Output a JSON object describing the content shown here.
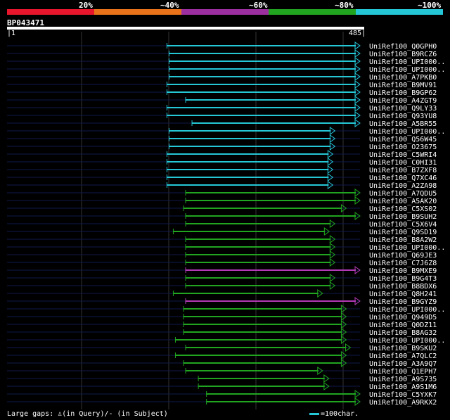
{
  "scale": {
    "labels": [
      "20%",
      "~40%",
      "~60%",
      "~80%",
      "~100%"
    ],
    "band_colors": [
      "#e8162c",
      "#e8731a",
      "#9b2fa0",
      "#21a520",
      "#25c7d6"
    ]
  },
  "query": {
    "name": "BP043471",
    "start": "1",
    "end": "485",
    "length": 485
  },
  "colors": {
    "cyan": "#25c7d6",
    "green": "#21a520",
    "purple": "#b33ab5",
    "track": "#101a4a",
    "grid": "#333"
  },
  "hits": [
    {
      "name": "UniRef100_Q0GPH0",
      "start": 0.453,
      "end": 1.0,
      "color": "cyan"
    },
    {
      "name": "UniRef100_B9RCZ6",
      "start": 0.459,
      "end": 1.0,
      "color": "cyan"
    },
    {
      "name": "UniRef100_UPI000..",
      "start": 0.459,
      "end": 1.0,
      "color": "cyan"
    },
    {
      "name": "UniRef100_UPI000..",
      "start": 0.459,
      "end": 1.0,
      "color": "cyan"
    },
    {
      "name": "UniRef100_A7PKB0",
      "start": 0.459,
      "end": 1.0,
      "color": "cyan"
    },
    {
      "name": "UniRef100_B9MV91",
      "start": 0.453,
      "end": 1.0,
      "color": "cyan"
    },
    {
      "name": "UniRef100_B9GP62",
      "start": 0.453,
      "end": 1.0,
      "color": "cyan"
    },
    {
      "name": "UniRef100_A4ZGT9",
      "start": 0.506,
      "end": 1.0,
      "color": "cyan"
    },
    {
      "name": "UniRef100_Q9LY33",
      "start": 0.453,
      "end": 1.0,
      "color": "cyan"
    },
    {
      "name": "UniRef100_Q93YU8",
      "start": 0.453,
      "end": 1.0,
      "color": "cyan"
    },
    {
      "name": "UniRef100_A5BR55",
      "start": 0.524,
      "end": 1.0,
      "color": "cyan"
    },
    {
      "name": "UniRef100_UPI000..",
      "start": 0.459,
      "end": 0.929,
      "color": "cyan"
    },
    {
      "name": "UniRef100_Q56W45",
      "start": 0.459,
      "end": 0.929,
      "color": "cyan"
    },
    {
      "name": "UniRef100_O23675",
      "start": 0.459,
      "end": 0.929,
      "color": "cyan"
    },
    {
      "name": "UniRef100_C5WRI4",
      "start": 0.453,
      "end": 0.923,
      "color": "cyan"
    },
    {
      "name": "UniRef100_C0HI31",
      "start": 0.453,
      "end": 0.923,
      "color": "cyan"
    },
    {
      "name": "UniRef100_B7ZXF8",
      "start": 0.453,
      "end": 0.923,
      "color": "cyan"
    },
    {
      "name": "UniRef100_Q7XC46",
      "start": 0.453,
      "end": 0.923,
      "color": "cyan"
    },
    {
      "name": "UniRef100_A2ZA98",
      "start": 0.453,
      "end": 0.923,
      "color": "cyan"
    },
    {
      "name": "UniRef100_A7QDU5",
      "start": 0.506,
      "end": 1.0,
      "color": "green"
    },
    {
      "name": "UniRef100_A5AK20",
      "start": 0.506,
      "end": 1.0,
      "color": "green"
    },
    {
      "name": "UniRef100_C5XS02",
      "start": 0.5,
      "end": 0.961,
      "color": "green"
    },
    {
      "name": "UniRef100_B9SUH2",
      "start": 0.506,
      "end": 1.0,
      "color": "green"
    },
    {
      "name": "UniRef100_C5X6V4",
      "start": 0.506,
      "end": 0.929,
      "color": "green"
    },
    {
      "name": "UniRef100_Q9SD19",
      "start": 0.471,
      "end": 0.913,
      "color": "green"
    },
    {
      "name": "UniRef100_B8A2W2",
      "start": 0.506,
      "end": 0.929,
      "color": "green"
    },
    {
      "name": "UniRef100_UPI000..",
      "start": 0.506,
      "end": 0.929,
      "color": "green"
    },
    {
      "name": "UniRef100_Q69JE3",
      "start": 0.506,
      "end": 0.929,
      "color": "green"
    },
    {
      "name": "UniRef100_C7J6Z8",
      "start": 0.506,
      "end": 0.929,
      "color": "green"
    },
    {
      "name": "UniRef100_B9MXE9",
      "start": 0.506,
      "end": 1.0,
      "color": "purple"
    },
    {
      "name": "UniRef100_B9G4T3",
      "start": 0.506,
      "end": 0.929,
      "color": "green"
    },
    {
      "name": "UniRef100_B8BDX6",
      "start": 0.506,
      "end": 0.929,
      "color": "green"
    },
    {
      "name": "UniRef100_Q8H241",
      "start": 0.471,
      "end": 0.894,
      "color": "green"
    },
    {
      "name": "UniRef100_B9GYZ9",
      "start": 0.506,
      "end": 1.0,
      "color": "purple"
    },
    {
      "name": "UniRef100_UPI000..",
      "start": 0.5,
      "end": 0.961,
      "color": "green"
    },
    {
      "name": "UniRef100_Q949D5",
      "start": 0.5,
      "end": 0.961,
      "color": "green"
    },
    {
      "name": "UniRef100_Q0DZ11",
      "start": 0.5,
      "end": 0.961,
      "color": "green"
    },
    {
      "name": "UniRef100_B8AG32",
      "start": 0.5,
      "end": 0.961,
      "color": "green"
    },
    {
      "name": "UniRef100_UPI000..",
      "start": 0.477,
      "end": 0.961,
      "color": "green"
    },
    {
      "name": "UniRef100_B9SKU2",
      "start": 0.506,
      "end": 0.973,
      "color": "green"
    },
    {
      "name": "UniRef100_A7QLC2",
      "start": 0.477,
      "end": 0.961,
      "color": "green"
    },
    {
      "name": "UniRef100_A3A9Q7",
      "start": 0.5,
      "end": 0.961,
      "color": "green"
    },
    {
      "name": "UniRef100_Q1EPH7",
      "start": 0.506,
      "end": 0.894,
      "color": "green"
    },
    {
      "name": "UniRef100_A9S735",
      "start": 0.542,
      "end": 0.912,
      "color": "green"
    },
    {
      "name": "UniRef100_A9S1M6",
      "start": 0.542,
      "end": 0.912,
      "color": "green"
    },
    {
      "name": "UniRef100_C5YXK7",
      "start": 0.565,
      "end": 1.0,
      "color": "green"
    },
    {
      "name": "UniRef100_A9RKX2",
      "start": 0.565,
      "end": 1.0,
      "color": "green"
    }
  ],
  "legend": {
    "gaps_text": "Large gaps: ♙(in Query)/- (in Subject)",
    "scale_text": "=100char."
  }
}
